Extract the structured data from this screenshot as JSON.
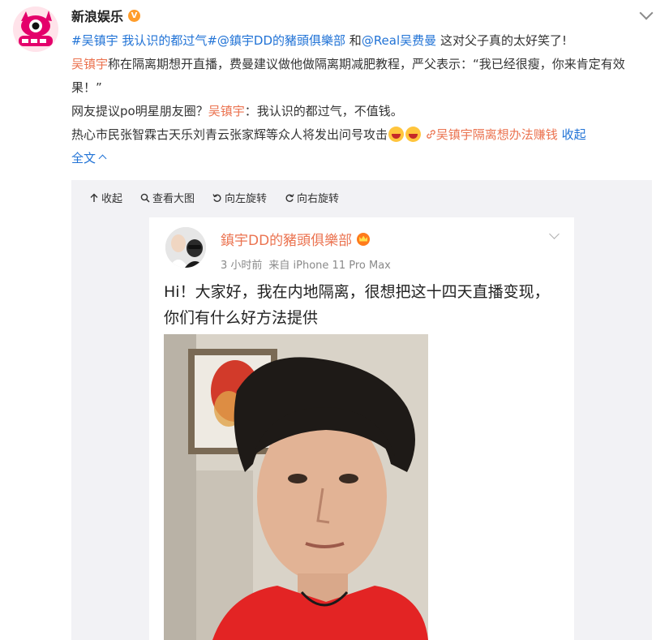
{
  "post": {
    "author": "新浪娱乐",
    "hashtag": "#吴镇宇 我认识的都过气#",
    "mention1": "@鎮宇DD的豬頭俱樂部",
    "join": "和",
    "mention2": "@Real吴费曼",
    "headline_tail": "这对父子真的太好笑了!",
    "p2_name": "吴镇宇",
    "p2_text": "称在隔离期想开直播，费曼建议做他做隔离期减肥教程，严父表示：“我已经很瘦，你来肯定有效果！”",
    "p3_text": "网友提议po明星朋友圈？",
    "p3_name": "吴镇宇",
    "p3_tail": "：我认识的都过气，不值钱。",
    "p4_text": "热心市民张智霖古天乐刘青云张家辉等众人将发出问号攻击",
    "topic_link": "吴镇宇隔离想办法赚钱",
    "collapse": "收起",
    "full_text": "全文"
  },
  "toolbar": {
    "collapse": "收起",
    "view_large": "查看大图",
    "rotate_left": "向左旋转",
    "rotate_right": "向右旋转"
  },
  "card": {
    "username": "鎮宇DD的豬頭俱樂部",
    "time": "3 小时前",
    "source": "来自 iPhone 11 Pro Max",
    "text": "Hi！大家好，我在内地隔离，很想把这十四天直播变现，你们有什么好方法提供"
  },
  "icons": {
    "verified": "verified-badge-icon",
    "emoji": "laughing-face-icon",
    "link": "link-icon",
    "crown": "crown-badge-icon"
  },
  "colors": {
    "link_orange": "#eb7350",
    "link_blue": "#2173d6",
    "media_bg": "#f2f2f5",
    "verified": "#ff9d2b"
  }
}
